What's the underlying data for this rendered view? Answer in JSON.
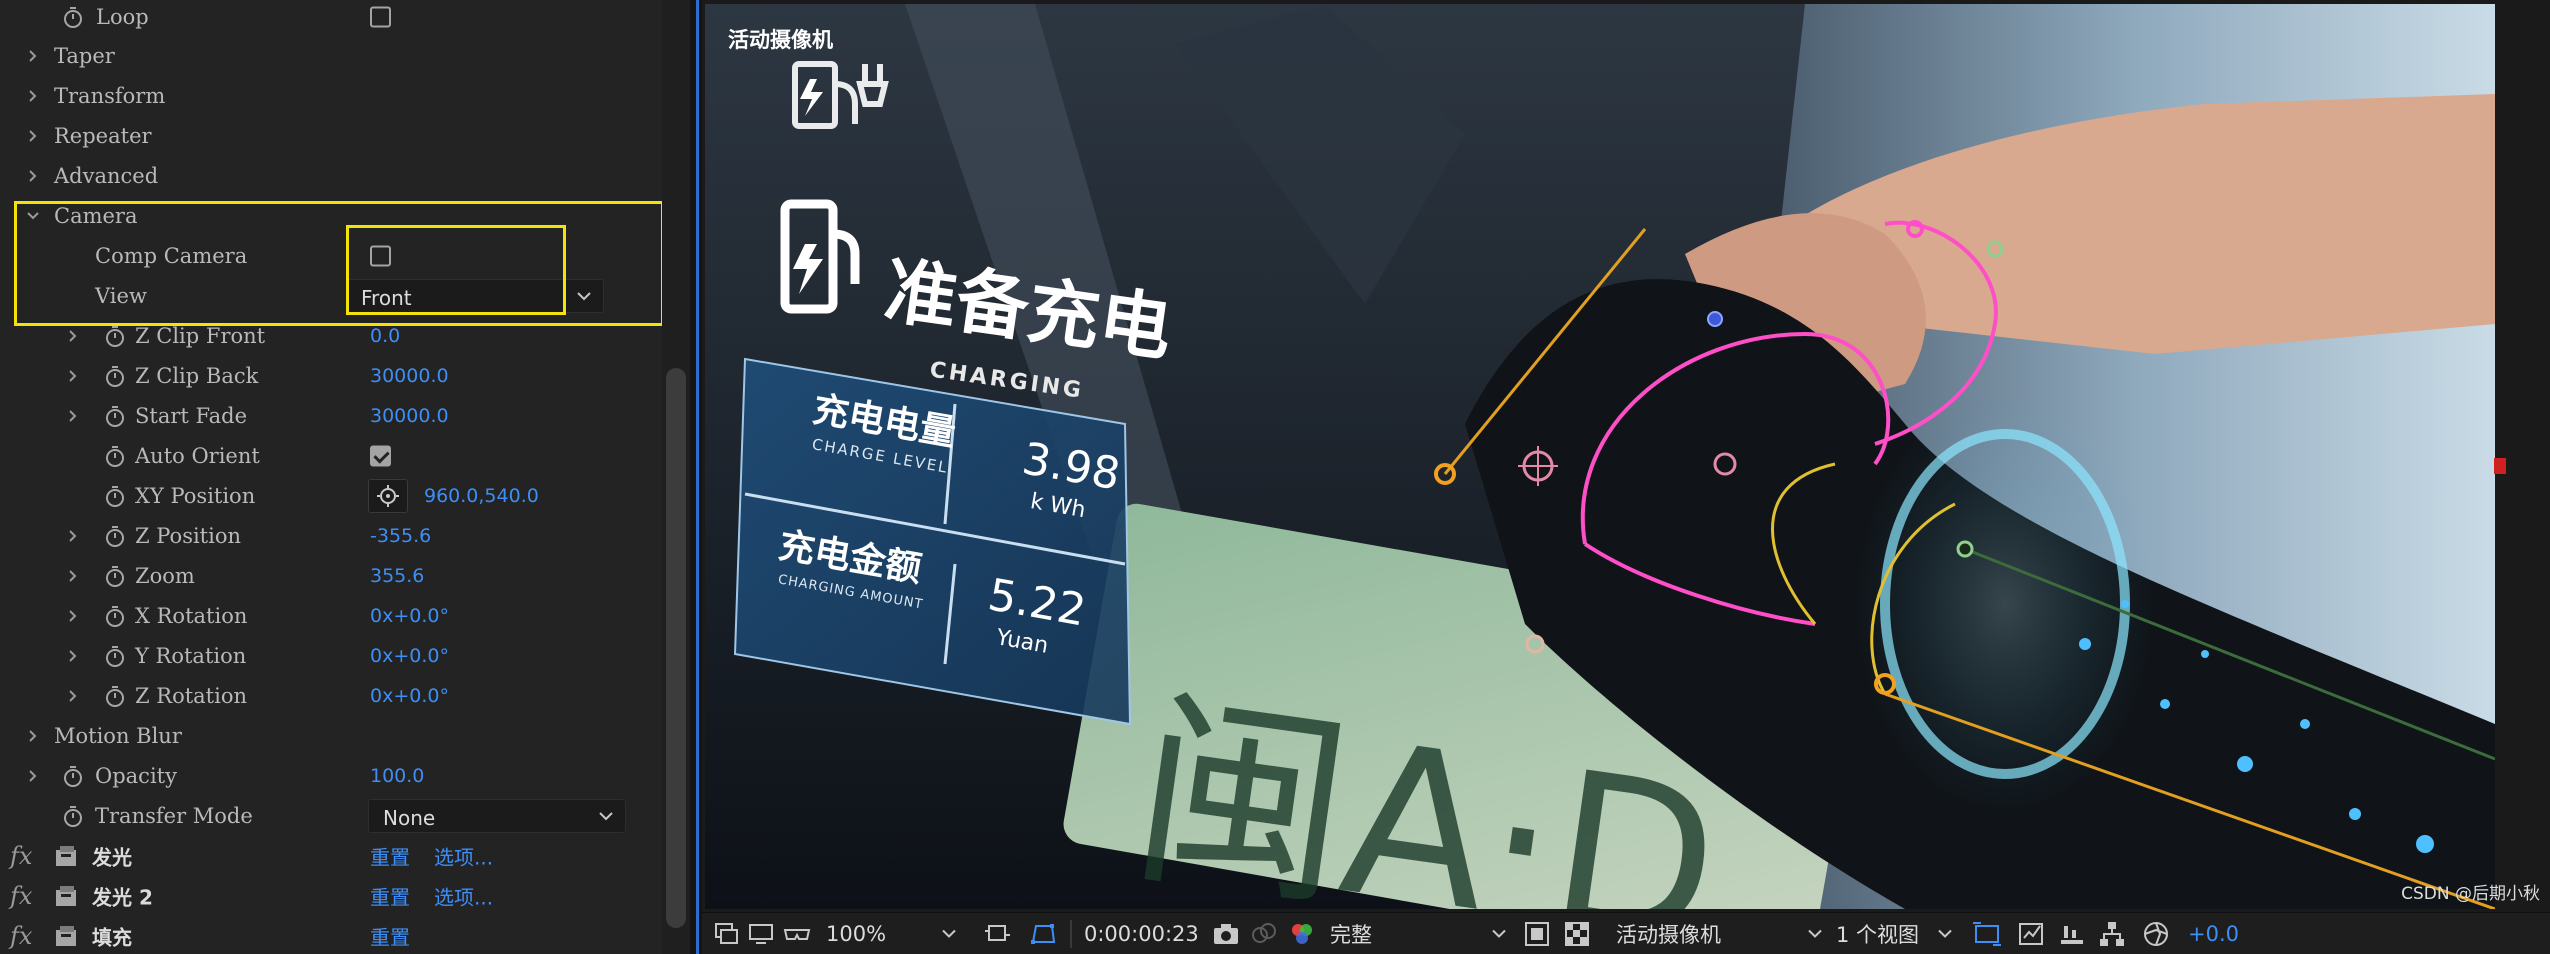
{
  "effects_panel": {
    "rows": [
      {
        "label": "Loop",
        "kind": "checkbox",
        "checked": false
      },
      {
        "label": "Taper",
        "kind": "group"
      },
      {
        "label": "Transform",
        "kind": "group"
      },
      {
        "label": "Repeater",
        "kind": "group"
      },
      {
        "label": "Advanced",
        "kind": "group"
      },
      {
        "label": "Camera",
        "kind": "group-open"
      },
      {
        "label": "Comp Camera",
        "kind": "checkbox",
        "checked": false
      },
      {
        "label": "View",
        "kind": "dropdown",
        "value": "Front"
      },
      {
        "label": "Z Clip Front",
        "kind": "value",
        "value": "0.0"
      },
      {
        "label": "Z Clip Back",
        "kind": "value",
        "value": "30000.0"
      },
      {
        "label": "Start Fade",
        "kind": "value",
        "value": "30000.0"
      },
      {
        "label": "Auto Orient",
        "kind": "checkbox",
        "checked": true
      },
      {
        "label": "XY Position",
        "kind": "point",
        "value": "960.0,540.0"
      },
      {
        "label": "Z Position",
        "kind": "value",
        "value": "-355.6"
      },
      {
        "label": "Zoom",
        "kind": "value",
        "value": "355.6"
      },
      {
        "label": "X Rotation",
        "kind": "value",
        "value": "0x+0.0°"
      },
      {
        "label": "Y Rotation",
        "kind": "value",
        "value": "0x+0.0°"
      },
      {
        "label": "Z Rotation",
        "kind": "value",
        "value": "0x+0.0°"
      },
      {
        "label": "Motion Blur",
        "kind": "group"
      },
      {
        "label": "Opacity",
        "kind": "value",
        "value": "100.0"
      },
      {
        "label": "Transfer Mode",
        "kind": "dropdown",
        "value": "None"
      }
    ],
    "effects": [
      {
        "fx": "fx",
        "name": "发光",
        "reset": "重置",
        "options": "选项..."
      },
      {
        "fx": "fx",
        "name": "发光 2",
        "reset": "重置",
        "options": "选项..."
      },
      {
        "fx": "fx",
        "name": "填充",
        "reset": "重置",
        "options": ""
      }
    ]
  },
  "viewer": {
    "camera_label": "活动摄像机",
    "overlay": {
      "title_cn": "准备充电",
      "title_en": "CHARGING",
      "level_cn": "充电电量",
      "level_en": "CHARGE LEVEL",
      "level_value": "3.98",
      "level_unit": "k Wh",
      "amount_cn": "充电金额",
      "amount_en": "CHARGING AMOUNT",
      "amount_value": "5.22",
      "amount_unit": "Yuan",
      "plate_text": "闽A·D"
    },
    "watermark": "CSDN @后期小秋"
  },
  "toolbar": {
    "zoom": "100%",
    "timecode": "0:00:00:23",
    "resolution": "完整",
    "camera": "活动摄像机",
    "views": "1 个视图",
    "exposure": "+0.0"
  },
  "colors": {
    "accent_blue": "#3d8ef5",
    "highlight_yellow": "#f4e20b",
    "panel_bg": "#232323"
  }
}
